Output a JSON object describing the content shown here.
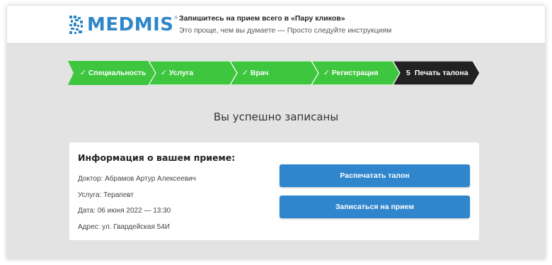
{
  "header": {
    "logo_text": "MEDMIS",
    "logo_reg": "®",
    "title": "Запишитесь на прием всего в «Пару кликов»",
    "subtitle": "Это проще, чем вы думаете — Просто следуйте инструкциям"
  },
  "steps": [
    {
      "check": "✓",
      "label": "Специальность",
      "status": "done"
    },
    {
      "check": "✓",
      "label": "Услуга",
      "status": "done"
    },
    {
      "check": "✓",
      "label": "Врач",
      "status": "done"
    },
    {
      "check": "✓",
      "label": "Регистрация",
      "status": "done"
    },
    {
      "number": "5",
      "label": "Печать талона",
      "status": "current"
    }
  ],
  "colors": {
    "brand": "#2e86c9",
    "step_done": "#3ec63e",
    "step_current": "#222222",
    "button": "#2f86cd",
    "page_bg": "#e3e3e3"
  },
  "main": {
    "success_title": "Вы успешно записаны",
    "card": {
      "title": "Информация о вашем приеме:",
      "doctor": "Доктор: Абрамов Артур Алексеевич",
      "service": "Услуга: Терапевт",
      "date": "Дата: 06 июня 2022 — 13:30",
      "address": "Адрес: ул. Гвардейская 54И"
    },
    "buttons": {
      "print": "Распечатать талон",
      "book": "Записаться на прием"
    }
  }
}
